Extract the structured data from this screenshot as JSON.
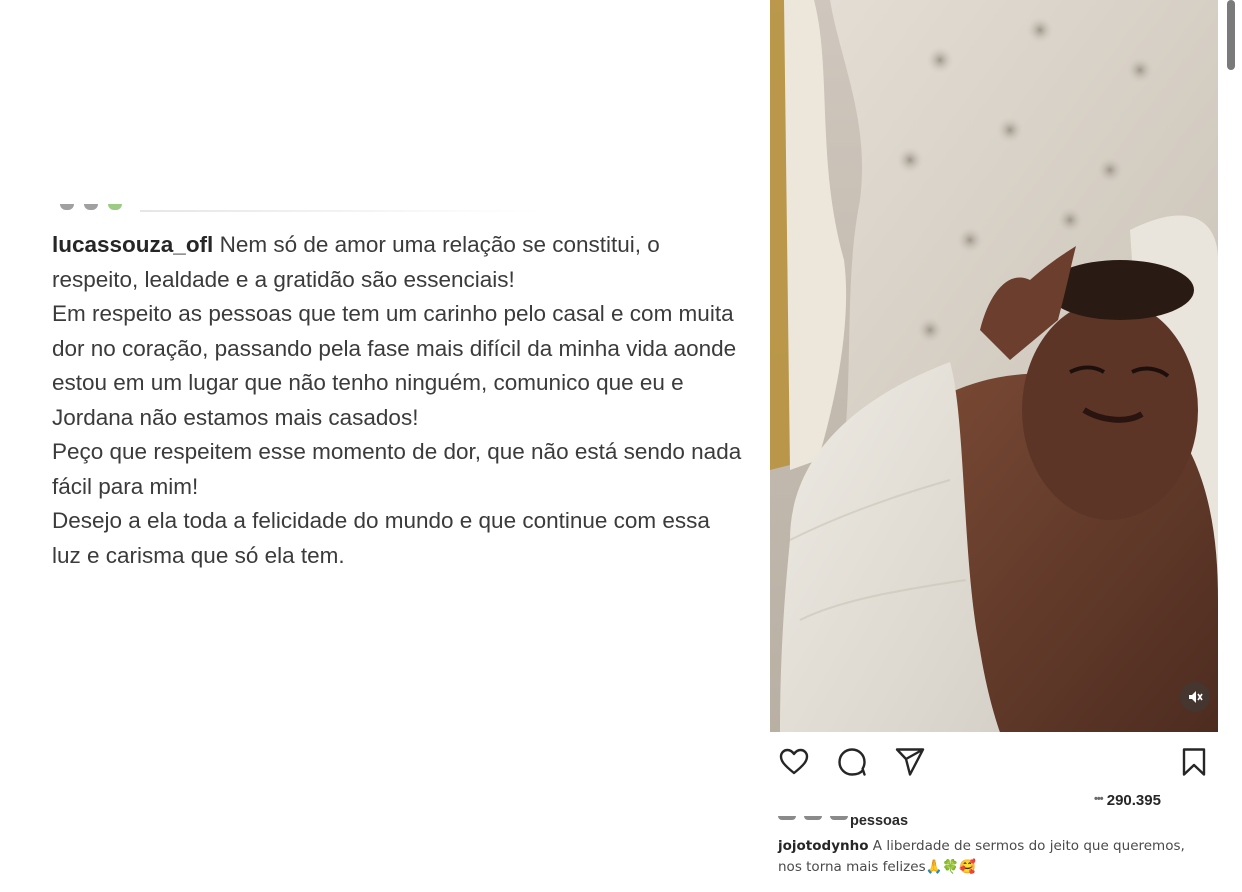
{
  "left_post": {
    "username": "lucassouza_ofl",
    "caption_lines": [
      " Nem só de amor uma relação se constitui, o respeito, lealdade e a gratidão são essenciais!",
      "Em respeito as pessoas que tem um carinho pelo casal e com muita dor no coração, passando pela fase mais difícil da minha vida aonde estou em um lugar que não tenho ninguém, comunico que eu e Jordana não estamos mais casados!",
      "Peço que respeitem esse momento de dor, que não está sendo nada fácil para mim!",
      "Desejo a ela toda a felicidade do mundo e que continue com essa luz e carisma que só ela tem."
    ]
  },
  "right_post": {
    "likes_prefix_cut": "•••",
    "likes_count": "290.395",
    "likers_label": "pessoas",
    "username": "jojotodynho",
    "caption": " A liberdade de sermos do jeito que queremos, nos torna mais felizes🙏🍀🥰",
    "icons": {
      "like": "heart-icon",
      "comment": "comment-icon",
      "share": "send-icon",
      "save": "bookmark-icon",
      "mute": "muted-speaker-icon"
    }
  }
}
